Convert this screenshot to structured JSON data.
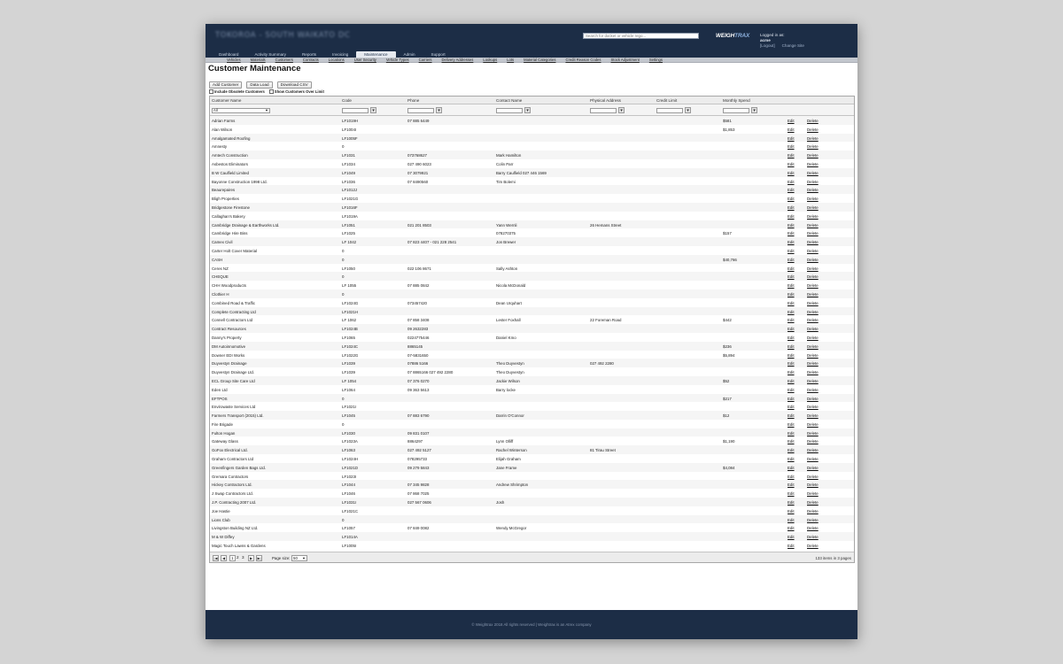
{
  "header": {
    "site_title": "TOKOROA - SOUTH WAIKATO DC",
    "search_placeholder": "Search for docket or vehicle rego...",
    "logo_main": "WEIGH",
    "logo_accent": "TRAX",
    "logged_in_label": "Logged in as:",
    "logged_in_user": "acme",
    "logout": "[Logout]",
    "change_site": "Change Site"
  },
  "main_tabs": [
    "Dashboard",
    "Activity Summary",
    "Reports",
    "Invoicing",
    "Maintenance",
    "Admin",
    "Support"
  ],
  "active_tab": "Maintenance",
  "sub_nav": [
    "Vehicles",
    "Materials",
    "Customers",
    "Contracts",
    "Locations",
    "User Security",
    "Vehicle Types",
    "Carriers",
    "Delivery Addresses",
    "Lookups",
    "Lots",
    "Material Categories",
    "Credit Reason Codes",
    "Stock Adjustment",
    "Settings"
  ],
  "page_title": "Customer Maintenance",
  "buttons": {
    "add": "Add Customer",
    "data_load": "Data Load",
    "download": "Download CSV"
  },
  "checkboxes": {
    "obsolete": "Include Obsolete Customers",
    "over_limit": "Show Customers Over Limit"
  },
  "columns": {
    "name": "Customer Name",
    "code": "Code",
    "phone": "Phone",
    "contact": "Contact Name",
    "address": "Physical Address",
    "credit": "Credit Limit",
    "spend": "Monthly Spend"
  },
  "filter": {
    "name_value": "All",
    "filter_icon": "filter-icon"
  },
  "row_actions": {
    "edit": "Edit",
    "delete": "Delete"
  },
  "rows": [
    {
      "name": "Adrian Farms",
      "code": "LF1019H",
      "phone": "07 885 6449",
      "contact": "",
      "address": "",
      "credit": "",
      "spend": "$581"
    },
    {
      "name": "Alan Wilson",
      "code": "LF1004I",
      "phone": "",
      "contact": "",
      "address": "",
      "credit": "",
      "spend": "$1,853"
    },
    {
      "name": "Amalgamated Roofing",
      "code": "LF1005F",
      "phone": "",
      "contact": "",
      "address": "",
      "credit": "",
      "spend": ""
    },
    {
      "name": "Amnesty",
      "code": "0",
      "phone": "",
      "contact": "",
      "address": "",
      "credit": "",
      "spend": ""
    },
    {
      "name": "Amtech Construction",
      "code": "LF1031",
      "phone": "073768627",
      "contact": "Mark Hamilton",
      "address": "",
      "credit": "",
      "spend": ""
    },
    {
      "name": "Asbestos Eliminators",
      "code": "LF1034",
      "phone": "027 490 6023",
      "contact": "Colin Parr",
      "address": "",
      "credit": "",
      "spend": ""
    },
    {
      "name": "B W Caulfield Limited",
      "code": "LF1049",
      "phone": "07 3079921",
      "contact": "Barry Caulfield 027 446 1569",
      "address": "",
      "credit": "",
      "spend": ""
    },
    {
      "name": "Bayonne Construction 1998 Ltd.",
      "code": "LF1036",
      "phone": "07 8490560",
      "contact": "Tim Bolemi",
      "address": "",
      "credit": "",
      "spend": ""
    },
    {
      "name": "Beaurepaires",
      "code": "LF1012J",
      "phone": "",
      "contact": "",
      "address": "",
      "credit": "",
      "spend": ""
    },
    {
      "name": "Bligh Properties",
      "code": "LF1021G",
      "phone": "",
      "contact": "",
      "address": "",
      "credit": "",
      "spend": ""
    },
    {
      "name": "Bridgestone Firestone",
      "code": "LF1016F",
      "phone": "",
      "contact": "",
      "address": "",
      "credit": "",
      "spend": ""
    },
    {
      "name": "Callaghan's Bakery",
      "code": "LF1019A",
      "phone": "",
      "contact": "",
      "address": "",
      "credit": "",
      "spend": ""
    },
    {
      "name": "Cambridge Drainage & Earthworks Ltd.",
      "code": "LF1051",
      "phone": "021 201 8503",
      "contact": "Yann Wernli",
      "address": "26 Hemans Street",
      "credit": "",
      "spend": ""
    },
    {
      "name": "Cambridge Hire Bins",
      "code": "LF1025",
      "phone": "",
      "contact": "078270375",
      "address": "",
      "credit": "",
      "spend": "$157"
    },
    {
      "name": "Camex Civil",
      "code": "LF 1042",
      "phone": "07 823 4407 - 021 228 2541",
      "contact": "Jon Brewer",
      "address": "",
      "credit": "",
      "spend": ""
    },
    {
      "name": "Carter Holt Cover Material",
      "code": "0",
      "phone": "",
      "contact": "",
      "address": "",
      "credit": "",
      "spend": ""
    },
    {
      "name": "CASH",
      "code": "0",
      "phone": "",
      "contact": "",
      "address": "",
      "credit": "",
      "spend": "$40,766"
    },
    {
      "name": "Ceres NZ",
      "code": "LF1050",
      "phone": "022 106 8671",
      "contact": "Sally Ashton",
      "address": "",
      "credit": "",
      "spend": ""
    },
    {
      "name": "CHEQUE",
      "code": "0",
      "phone": "",
      "contact": "",
      "address": "",
      "credit": "",
      "spend": ""
    },
    {
      "name": "CHH Woodproducts",
      "code": "LF 1055",
      "phone": "07 885 0842",
      "contact": "Nicola McDonald",
      "address": "",
      "credit": "",
      "spend": ""
    },
    {
      "name": "Clothier H",
      "code": "0",
      "phone": "",
      "contact": "",
      "address": "",
      "credit": "",
      "spend": ""
    },
    {
      "name": "Combined Road & Traffic",
      "code": "LF1024G",
      "phone": "073457420",
      "contact": "Dean Urquhart",
      "address": "",
      "credit": "",
      "spend": ""
    },
    {
      "name": "Complete Contracting Ltd",
      "code": "LF1021H",
      "phone": "",
      "contact": "",
      "address": "",
      "credit": "",
      "spend": ""
    },
    {
      "name": "Connell Contractors Ltd",
      "code": "LF 1062",
      "phone": "07 858 3408",
      "contact": "Lester Foxhall",
      "address": "22 Foreman Road",
      "credit": "",
      "spend": "$442"
    },
    {
      "name": "Contract Resources",
      "code": "LF1024B",
      "phone": "09 2632283",
      "contact": "",
      "address": "",
      "credit": "",
      "spend": ""
    },
    {
      "name": "Danny's Property",
      "code": "LF1065",
      "phone": "0224775446",
      "contact": "Daniel Kmo",
      "address": "",
      "credit": "",
      "spend": ""
    },
    {
      "name": "DM Autoinnomotive",
      "code": "LF1024C",
      "phone": "8865145",
      "contact": "",
      "address": "",
      "credit": "",
      "spend": "$236"
    },
    {
      "name": "Downer EDI Works",
      "code": "LF1022G",
      "phone": "07-5831650",
      "contact": "",
      "address": "",
      "credit": "",
      "spend": "$5,894"
    },
    {
      "name": "Duyvestyn Drainage",
      "code": "LF1039",
      "phone": "07886 5166",
      "contact": "Theo Duyvestyn",
      "address": "027 492 2280",
      "credit": "",
      "spend": ""
    },
    {
      "name": "Duyvestyn Drainage Ltd.",
      "code": "LF1039",
      "phone": "07 8865166 027 492 2280",
      "contact": "Theo Duyvestyn",
      "address": "",
      "credit": "",
      "spend": ""
    },
    {
      "name": "ECL Group Site Care Ltd",
      "code": "LF 1054",
      "phone": "07 376 0270",
      "contact": "Jackie Wilson",
      "address": "",
      "credit": "",
      "spend": "$52"
    },
    {
      "name": "Eden Ltd",
      "code": "LF1064",
      "phone": "09 363 5613",
      "contact": "Barry locke",
      "address": "",
      "credit": "",
      "spend": ""
    },
    {
      "name": "EFTPOS",
      "code": "0",
      "phone": "",
      "contact": "",
      "address": "",
      "credit": "",
      "spend": "$217"
    },
    {
      "name": "Envirowaste Services Ltd",
      "code": "LF1021I",
      "phone": "",
      "contact": "",
      "address": "",
      "credit": "",
      "spend": ""
    },
    {
      "name": "Farmers Transport (2015) Ltd.",
      "code": "LF1045",
      "phone": "07 883 6790",
      "contact": "Darrin O'Connor",
      "address": "",
      "credit": "",
      "spend": "$12"
    },
    {
      "name": "Fire Brigade",
      "code": "0",
      "phone": "",
      "contact": "",
      "address": "",
      "credit": "",
      "spend": ""
    },
    {
      "name": "Fulton Hogan",
      "code": "LF1030",
      "phone": "09 831 0107",
      "contact": "",
      "address": "",
      "credit": "",
      "spend": ""
    },
    {
      "name": "Gateway Glass",
      "code": "LF1023A",
      "phone": "8864297",
      "contact": "Lynn Olliff",
      "address": "",
      "credit": "",
      "spend": "$1,190"
    },
    {
      "name": "GoFox Electrical Ltd.",
      "code": "LF1063",
      "phone": "027 492 5127",
      "contact": "Rachel Winterson",
      "address": "81 Tirau Street",
      "credit": "",
      "spend": ""
    },
    {
      "name": "Graham Contractors Ltd",
      "code": "LF1024H",
      "phone": "078295733",
      "contact": "Elijah Graham",
      "address": "",
      "credit": "",
      "spend": ""
    },
    {
      "name": "Greenfingers Garden Bags Ltd.",
      "code": "LF1021D",
      "phone": "09 279 5843",
      "contact": "Jane Frame",
      "address": "",
      "credit": "",
      "spend": "$4,084"
    },
    {
      "name": "Gremara Contractors",
      "code": "LF1023I",
      "phone": "",
      "contact": "",
      "address": "",
      "credit": "",
      "spend": ""
    },
    {
      "name": "Hickey Contractors Ltd.",
      "code": "LF1044",
      "phone": "07 345 9828",
      "contact": "Andrew Shrimpton",
      "address": "",
      "credit": "",
      "spend": ""
    },
    {
      "name": "J Swap Contractors Ltd.",
      "code": "LF1046",
      "phone": "07 868 7025",
      "contact": "",
      "address": "",
      "credit": "",
      "spend": ""
    },
    {
      "name": "J.P. Contracting 2007 Ltd.",
      "code": "LF1031I",
      "phone": "027 567 0606",
      "contact": "Josh",
      "address": "",
      "credit": "",
      "spend": ""
    },
    {
      "name": "Joe Hastie",
      "code": "LF1021C",
      "phone": "",
      "contact": "",
      "address": "",
      "credit": "",
      "spend": ""
    },
    {
      "name": "Lions Club",
      "code": "0",
      "phone": "",
      "contact": "",
      "address": "",
      "credit": "",
      "spend": ""
    },
    {
      "name": "Livingston Building NZ Ltd.",
      "code": "LF1057",
      "phone": "07 849 0082",
      "contact": "Wendy McGregor",
      "address": "",
      "credit": "",
      "spend": ""
    },
    {
      "name": "M & W Diffey",
      "code": "LF1014A",
      "phone": "",
      "contact": "",
      "address": "",
      "credit": "",
      "spend": ""
    },
    {
      "name": "Magic Touch Lawns & Gardens",
      "code": "LF1005I",
      "phone": "",
      "contact": "",
      "address": "",
      "credit": "",
      "spend": ""
    }
  ],
  "pager": {
    "first": "|◀",
    "prev": "◀",
    "pages": [
      "1",
      "2",
      "3"
    ],
    "current_page": "1",
    "next": "▶",
    "last": "▶|",
    "size_label": "Page size:",
    "size_value": "50",
    "info": "133 items in 3 pages"
  },
  "footer": "© Weightrax 2018 All rights reserved | Weightrax is an Atrex company"
}
